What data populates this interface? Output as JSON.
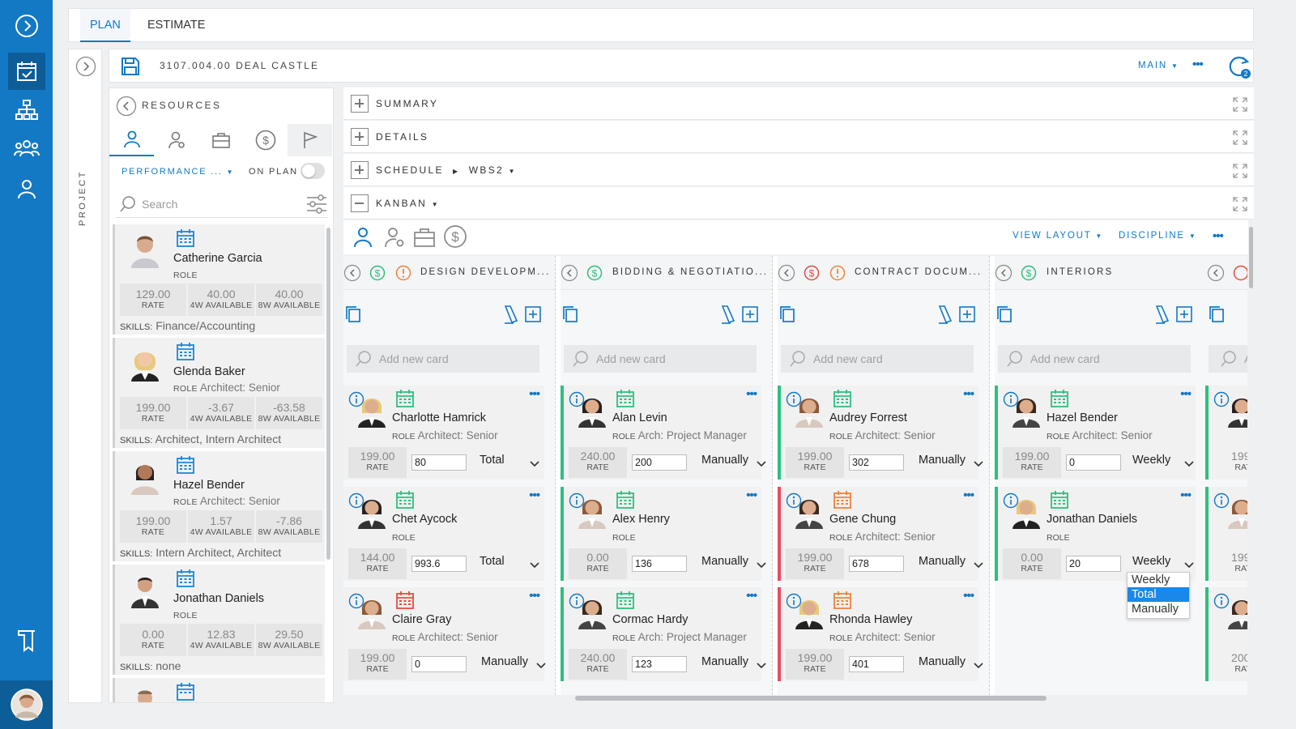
{
  "tabs": [
    {
      "label": "PLAN",
      "active": true
    },
    {
      "label": "ESTIMATE",
      "active": false
    }
  ],
  "project_strip_label": "PROJECT",
  "header": {
    "title": "3107.004.00 DEAL CASTLE",
    "view_label": "MAIN",
    "sync_badge": "2"
  },
  "resources": {
    "title": "RESOURCES",
    "filter_label": "PERFORMANCE ...",
    "on_plan_label": "ON PLAN",
    "on_plan_enabled": false,
    "search_placeholder": "Search",
    "tab_icons": [
      "person-icon",
      "person-gear-icon",
      "briefcase-icon",
      "dollar-icon",
      "flag-icon"
    ],
    "list": [
      {
        "name": "Catherine Garcia",
        "role_tag": "ROLE",
        "role": "",
        "rate": "129.00",
        "avail4w": "40.00",
        "avail8w": "40.00",
        "skills": "Finance/Accounting"
      },
      {
        "name": "Glenda Baker",
        "role_tag": "ROLE",
        "role": "Architect: Senior",
        "rate": "199.00",
        "avail4w": "-3.67",
        "avail8w": "-63.58",
        "skills": "Architect, Intern Architect"
      },
      {
        "name": "Hazel Bender",
        "role_tag": "ROLE",
        "role": "Architect: Senior",
        "rate": "199.00",
        "avail4w": "1.57",
        "avail8w": "-7.86",
        "skills": "Intern Architect, Architect"
      },
      {
        "name": "Jonathan Daniels",
        "role_tag": "ROLE",
        "role": "",
        "rate": "0.00",
        "avail4w": "12.83",
        "avail8w": "29.50",
        "skills": "none"
      }
    ],
    "stat_labels": {
      "rate": "RATE",
      "w4": "4W AVAILABLE",
      "w8": "8W AVAILABLE",
      "skills": "SKILLS:"
    }
  },
  "sections": [
    {
      "label": "SUMMARY",
      "expanded": false
    },
    {
      "label": "DETAILS",
      "expanded": false
    },
    {
      "label": "SCHEDULE",
      "expanded": false,
      "crumb": "WBS2"
    },
    {
      "label": "KANBAN",
      "expanded": true
    }
  ],
  "kanban": {
    "view_layout_label": "VIEW LAYOUT",
    "discipline_label": "DISCIPLINE",
    "add_card_placeholder": "Add new card",
    "rate_label": "RATE",
    "columns": [
      {
        "name": "DESIGN DEVELOPM...",
        "money_color": "#2ebf7f",
        "warn": true,
        "cards": [
          {
            "name": "Charlotte Hamrick",
            "role": "Architect: Senior",
            "rate": "199.00",
            "hours": "80",
            "mode": "Total",
            "flag": "none",
            "cal_color": "#2ebf7f"
          },
          {
            "name": "Chet Aycock",
            "role": "",
            "rate": "144.00",
            "hours": "993.6",
            "mode": "Total",
            "flag": "none",
            "cal_color": "#2ebf7f"
          },
          {
            "name": "Claire Gray",
            "role": "Architect: Senior",
            "rate": "199.00",
            "hours": "0",
            "mode": "Manually",
            "flag": "none",
            "cal_color": "#e84b3c"
          }
        ]
      },
      {
        "name": "BIDDING & NEGOTIATIO...",
        "money_color": "#2ebf7f",
        "warn": false,
        "cards": [
          {
            "name": "Alan Levin",
            "role": "Arch: Project Manager",
            "rate": "240.00",
            "hours": "200",
            "mode": "Manually",
            "flag": "green",
            "cal_color": "#2ebf7f"
          },
          {
            "name": "Alex Henry",
            "role": "",
            "rate": "0.00",
            "hours": "136",
            "mode": "Manually",
            "flag": "green",
            "cal_color": "#2ebf7f"
          },
          {
            "name": "Cormac Hardy",
            "role": "Arch: Project Manager",
            "rate": "240.00",
            "hours": "123",
            "mode": "Manually",
            "flag": "green",
            "cal_color": "#2ebf7f"
          }
        ]
      },
      {
        "name": "CONTRACT DOCUM...",
        "money_color": "#e84b3c",
        "warn": true,
        "cards": [
          {
            "name": "Audrey Forrest",
            "role": "Architect: Senior",
            "rate": "199.00",
            "hours": "302",
            "mode": "Manually",
            "flag": "green",
            "cal_color": "#2ebf7f"
          },
          {
            "name": "Gene Chung",
            "role": "Architect: Senior",
            "rate": "199.00",
            "hours": "678",
            "mode": "Manually",
            "flag": "red",
            "cal_color": "#f0823c"
          },
          {
            "name": "Rhonda Hawley",
            "role": "Architect: Senior",
            "rate": "199.00",
            "hours": "401",
            "mode": "Manually",
            "flag": "red",
            "cal_color": "#f0823c"
          }
        ]
      },
      {
        "name": "INTERIORS",
        "money_color": "#2ebf7f",
        "warn": false,
        "cards": [
          {
            "name": "Hazel Bender",
            "role": "Architect: Senior",
            "rate": "199.00",
            "hours": "0",
            "mode": "Weekly",
            "flag": "green",
            "cal_color": "#2ebf7f"
          },
          {
            "name": "Jonathan Daniels",
            "role": "",
            "rate": "0.00",
            "hours": "20",
            "mode": "Weekly",
            "flag": "green",
            "cal_color": "#2ebf7f"
          }
        ]
      }
    ],
    "partial_column": {
      "rates": [
        "199.(",
        "200.("
      ],
      "rate_label_partial": "RATI",
      "add_partial": "A"
    },
    "mode_dropdown": {
      "options": [
        "Weekly",
        "Total",
        "Manually"
      ],
      "selected": "Total"
    }
  }
}
